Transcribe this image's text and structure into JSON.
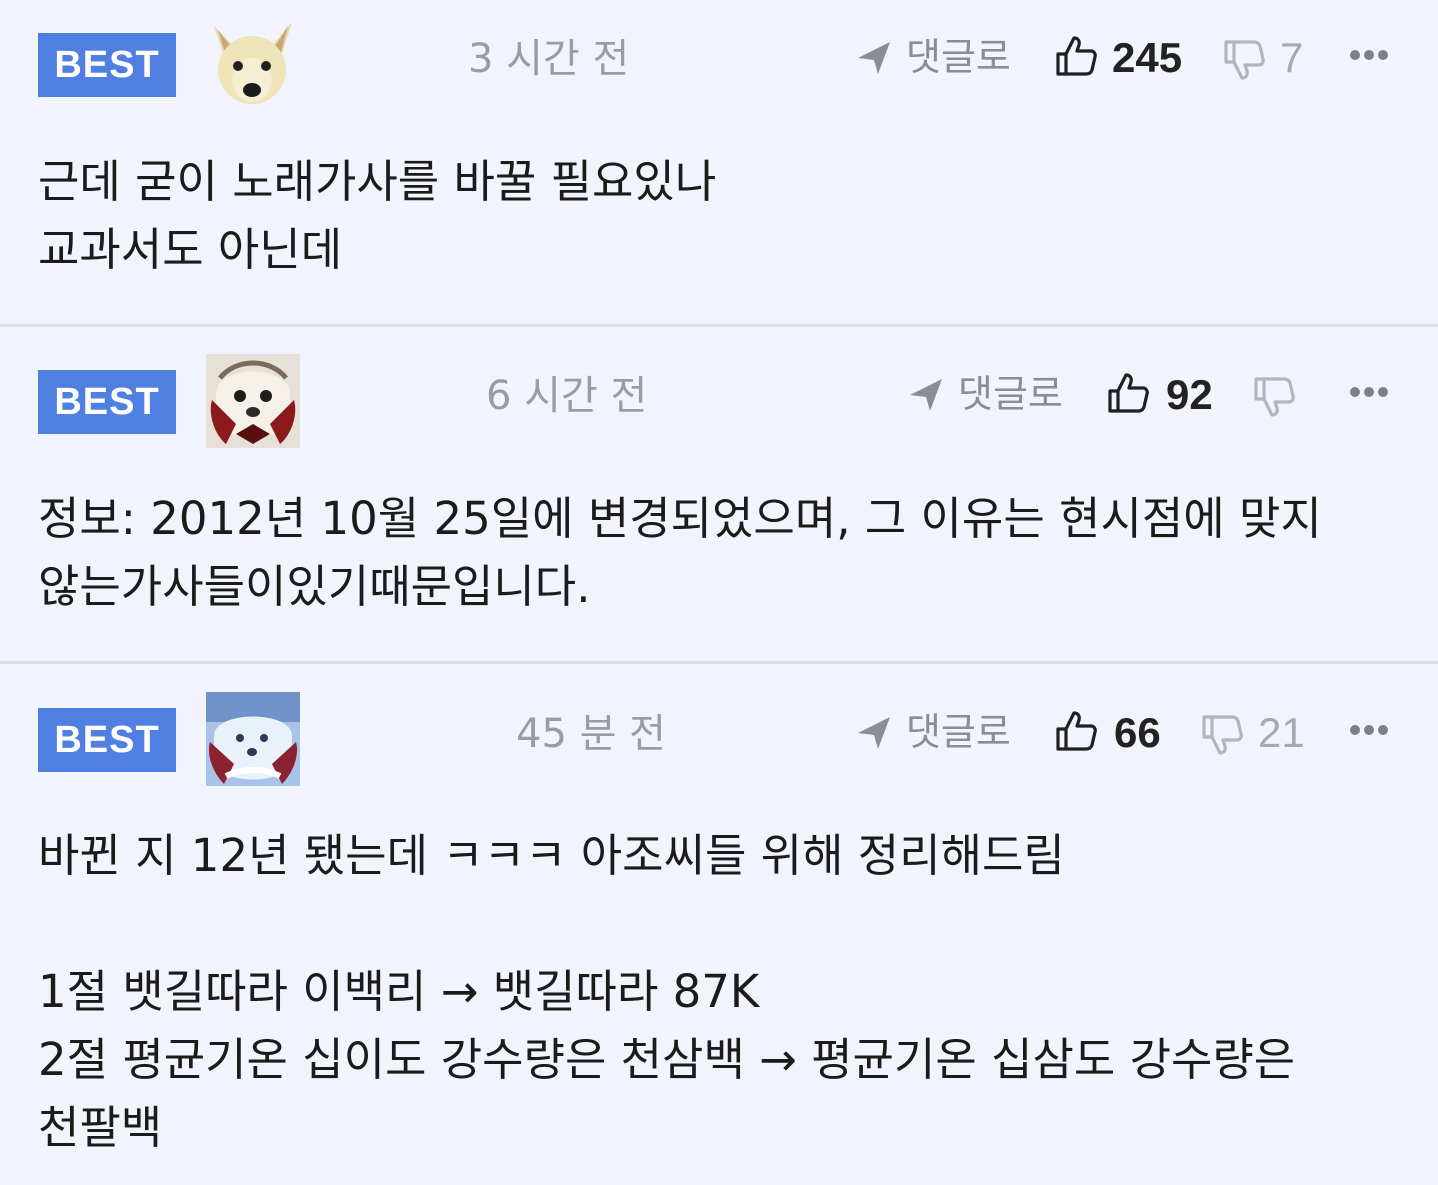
{
  "comments": [
    {
      "badge": "BEST",
      "time": "3 시간 전",
      "reply_label": "댓글로",
      "likes": "245",
      "dislikes": "7",
      "lines": [
        "근데 굳이 노래가사를 바꿀 필요있나",
        "교과서도 아닌데"
      ]
    },
    {
      "badge": "BEST",
      "time": "6 시간 전",
      "reply_label": "댓글로",
      "likes": "92",
      "dislikes": "",
      "lines": [
        "정보: 2012년 10월 25일에 변경되었으며, 그 이유는 현시점에 맞지",
        "않는가사들이있기때문입니다."
      ]
    },
    {
      "badge": "BEST",
      "time": "45 분 전",
      "reply_label": "댓글로",
      "likes": "66",
      "dislikes": "21",
      "lines": [
        "바뀐 지 12년 됐는데 ㅋㅋㅋ 아조씨들 위해 정리해드림",
        "",
        "1절 뱃길따라 이백리 → 뱃길따라 87K",
        "2절 평균기온 십이도 강수량은 천삼백 → 평균기온 십삼도 강수량은",
        "천팔백"
      ]
    }
  ],
  "icons": {
    "reply": "send-arrow-icon",
    "like": "thumbs-up-icon",
    "dislike": "thumbs-down-icon",
    "more": "more-dots-icon"
  },
  "colors": {
    "background": "#f2f4fd",
    "best_badge": "#4f80e1",
    "divider": "#dcdee6"
  }
}
